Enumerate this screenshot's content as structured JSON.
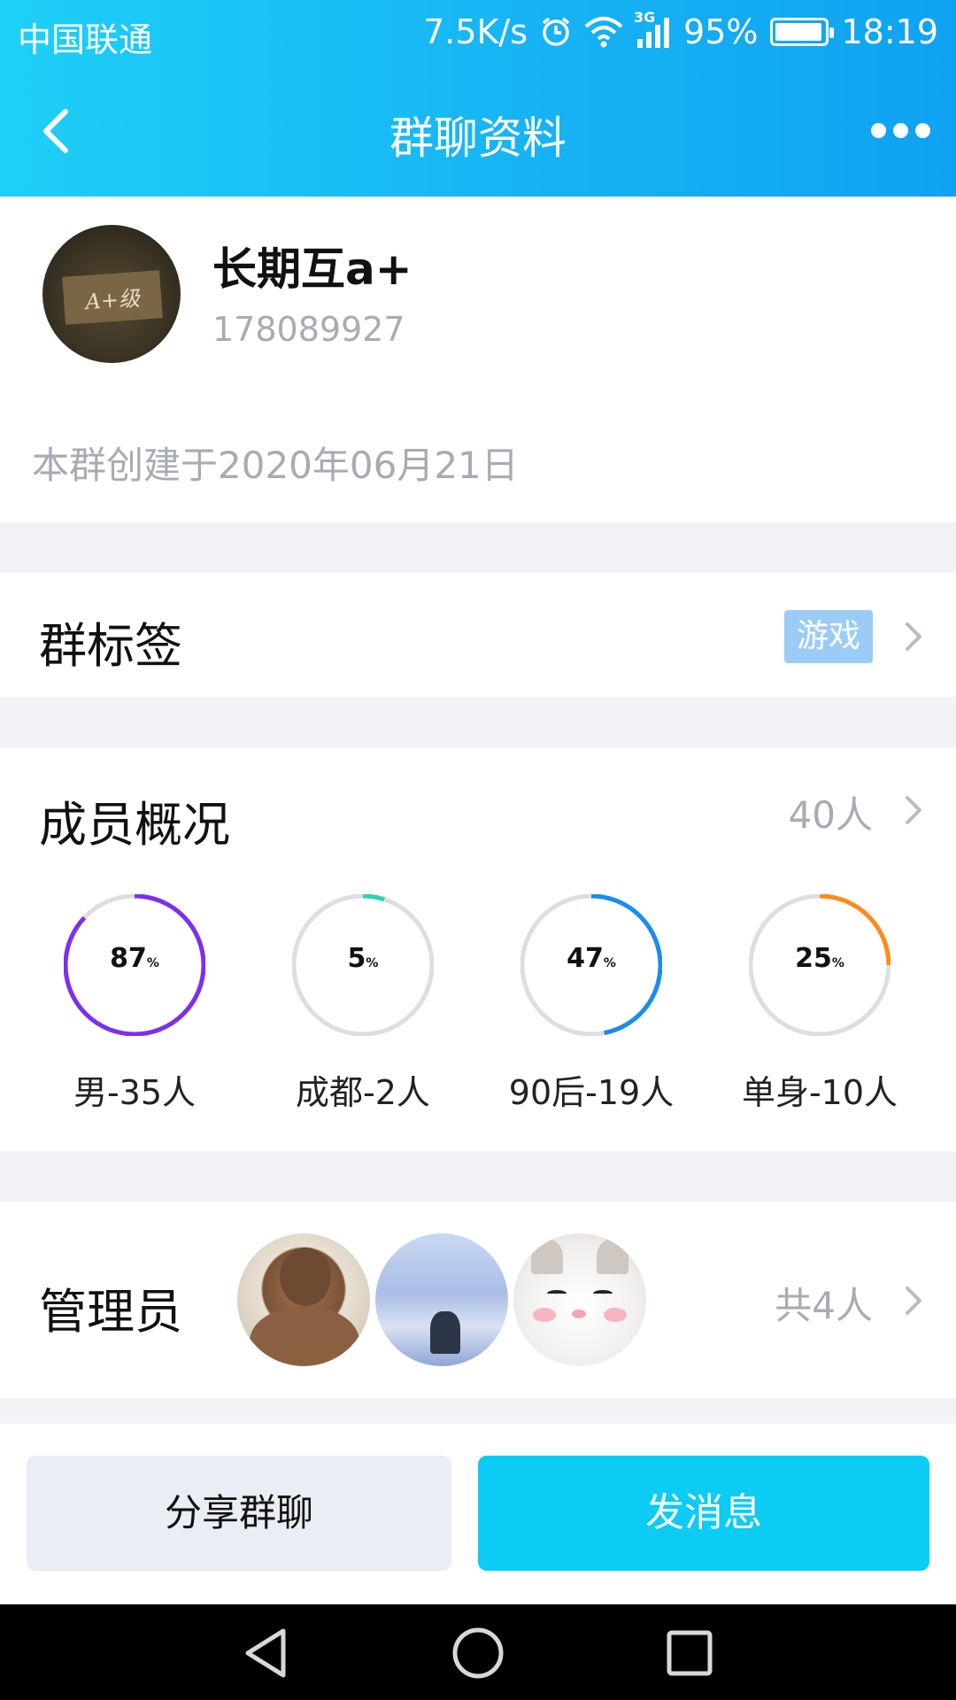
{
  "status_bar": {
    "carrier": "中国联通",
    "net_speed": "7.5K/s",
    "network_type": "3G",
    "battery": "95%",
    "battery_level": 0.95,
    "time": "18:19"
  },
  "nav": {
    "title": "群聊资料"
  },
  "group": {
    "name": "长期互a+",
    "id": "178089927",
    "created": "本群创建于2020年06月21日",
    "avatar_text": "A+级"
  },
  "tags": {
    "label": "群标签",
    "tag": "游戏"
  },
  "members": {
    "label": "成员概况",
    "count": "40人",
    "stats": [
      {
        "percent": "87",
        "unit": "%",
        "caption": "男-35人",
        "fraction": 0.87,
        "color": "#7b2ff2"
      },
      {
        "percent": "5",
        "unit": "%",
        "caption": "成都-2人",
        "fraction": 0.05,
        "color": "#2ed3b4"
      },
      {
        "percent": "47",
        "unit": "%",
        "caption": "90后-19人",
        "fraction": 0.47,
        "color": "#1a8cf0"
      },
      {
        "percent": "25",
        "unit": "%",
        "caption": "单身-10人",
        "fraction": 0.25,
        "color": "#ff8a1a"
      }
    ]
  },
  "admins": {
    "label": "管理员",
    "count": "共4人"
  },
  "actions": {
    "share": "分享群聊",
    "send": "发消息"
  },
  "colors": {
    "header_start": "#1ed0f7",
    "header_end": "#0fa2f2",
    "primary_button": "#0ccbf5",
    "tag_chip": "#9bccf6",
    "ring_track": "#dedede"
  }
}
